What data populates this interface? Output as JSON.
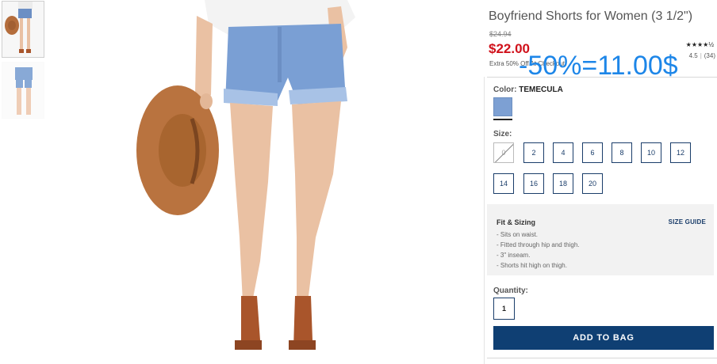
{
  "product": {
    "title": "Boyfriend Shorts for Women (3 1/2\")",
    "original_price": "$24.94",
    "price": "$22.00",
    "promo": "Extra 50% Off At Checkout",
    "stars": "★★★★½",
    "rating_value": "4.5",
    "rating_separator": "|",
    "review_count": "(34)"
  },
  "annotation": "-50%=11.00$",
  "color": {
    "label": "Color:",
    "value": "TEMECULA",
    "swatch_hex": "#7da0d3"
  },
  "size": {
    "label": "Size:",
    "options": [
      "0",
      "2",
      "4",
      "6",
      "8",
      "10",
      "12",
      "14",
      "16",
      "18",
      "20"
    ],
    "unavailable": [
      "0"
    ]
  },
  "fit": {
    "title": "Fit & Sizing",
    "size_guide_label": "SIZE GUIDE",
    "items": [
      "- Sits on waist.",
      "- Fitted through hip and thigh.",
      "- 3\" inseam.",
      "- Shorts hit high on thigh."
    ]
  },
  "quantity": {
    "label": "Quantity:",
    "value": "1"
  },
  "add_to_bag_label": "ADD TO BAG",
  "colors": {
    "price_red": "#d0111b",
    "navy": "#0f3f73",
    "annotation_blue": "#1d86e8"
  }
}
